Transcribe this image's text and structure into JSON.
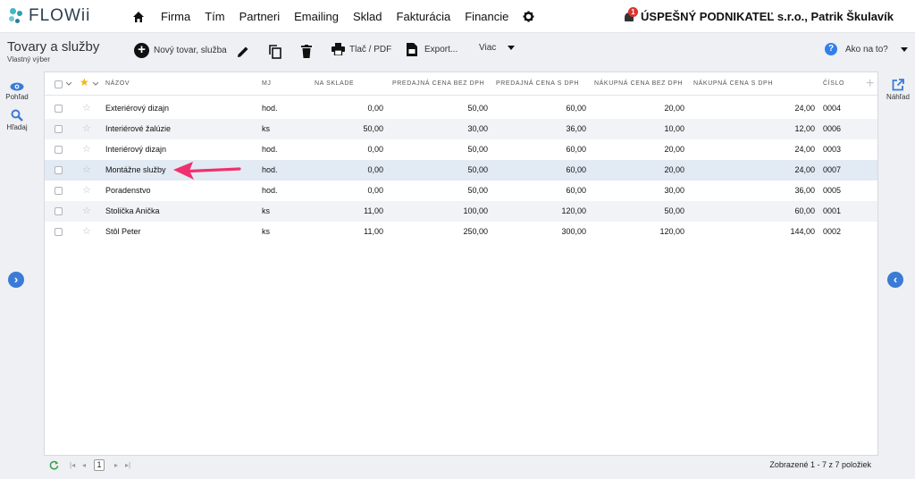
{
  "app": {
    "logo_text": "FLOWii"
  },
  "nav": {
    "items": [
      "Firma",
      "Tím",
      "Partneri",
      "Emailing",
      "Sklad",
      "Fakturácia",
      "Financie"
    ]
  },
  "header": {
    "notification_count": "1",
    "company": "ÚSPEŠNÝ PODNIKATEĽ s.r.o., Patrik Škulavík"
  },
  "toolbar": {
    "title": "Tovary a služby",
    "subtitle": "Vlastný výber",
    "new_label": "Nový tovar, služba",
    "print_label": "Tlač / PDF",
    "export_label": "Export...",
    "more_label": "Viac",
    "help_label": "Ako na to?"
  },
  "left_sidebar": {
    "view_label": "Pohľad",
    "search_label": "Hľadaj"
  },
  "right_sidebar": {
    "preview_label": "Náhľad"
  },
  "table": {
    "columns": [
      "Názov",
      "MJ",
      "Na sklade",
      "Predajná cena bez DPH",
      "Predajná cena s DPH",
      "Nákupná cena bez DPH",
      "Nákupná cena s DPH",
      "Číslo"
    ],
    "rows": [
      {
        "name": "Exteriérový dizajn",
        "unit": "hod.",
        "stock": "0,00",
        "sell_net": "50,00",
        "sell_gross": "60,00",
        "buy_net": "20,00",
        "buy_gross": "24,00",
        "number": "0004"
      },
      {
        "name": "Interiérové žalúzie",
        "unit": "ks",
        "stock": "50,00",
        "sell_net": "30,00",
        "sell_gross": "36,00",
        "buy_net": "10,00",
        "buy_gross": "12,00",
        "number": "0006"
      },
      {
        "name": "Interiérový dizajn",
        "unit": "hod.",
        "stock": "0,00",
        "sell_net": "50,00",
        "sell_gross": "60,00",
        "buy_net": "20,00",
        "buy_gross": "24,00",
        "number": "0003"
      },
      {
        "name": "Montážne služby",
        "unit": "hod.",
        "stock": "0,00",
        "sell_net": "50,00",
        "sell_gross": "60,00",
        "buy_net": "20,00",
        "buy_gross": "24,00",
        "number": "0007"
      },
      {
        "name": "Poradenstvo",
        "unit": "hod.",
        "stock": "0,00",
        "sell_net": "50,00",
        "sell_gross": "60,00",
        "buy_net": "30,00",
        "buy_gross": "36,00",
        "number": "0005"
      },
      {
        "name": "Stolička Anička",
        "unit": "ks",
        "stock": "11,00",
        "sell_net": "100,00",
        "sell_gross": "120,00",
        "buy_net": "50,00",
        "buy_gross": "60,00",
        "number": "0001"
      },
      {
        "name": "Stôl Peter",
        "unit": "ks",
        "stock": "11,00",
        "sell_net": "250,00",
        "sell_gross": "300,00",
        "buy_net": "120,00",
        "buy_gross": "144,00",
        "number": "0002"
      }
    ]
  },
  "footer": {
    "page": "1",
    "summary": "Zobrazené 1 - 7 z 7 položiek"
  },
  "colors": {
    "accent": "#3a7bd5",
    "highlight_arrow": "#f0306f",
    "selected_row": "#e2eaf3"
  }
}
